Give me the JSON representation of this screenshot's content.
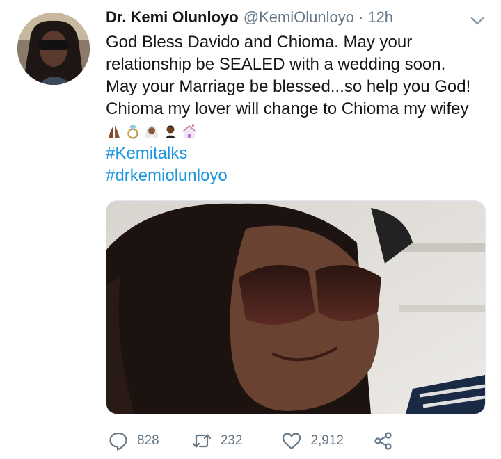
{
  "tweet": {
    "display_name": "Dr. Kemi Olunloyo",
    "handle": "@KemiOlunloyo",
    "separator": "·",
    "time": "12h",
    "lines": [
      "God Bless Davido and Chioma. May your",
      "relationship be SEALED with a wedding soon.",
      "May your Marriage be blessed...so help you God!",
      "Chioma my lover will change to Chioma my wifey"
    ],
    "emojis": [
      "praying-hands-icon",
      "ring-icon",
      "bride-icon",
      "groom-icon",
      "wedding-chapel-icon"
    ],
    "hashtags": [
      "#Kemitalks",
      "#drkemiolunloyo"
    ]
  },
  "actions": {
    "replies": "828",
    "retweets": "232",
    "likes": "2,912"
  },
  "colors": {
    "link": "#1b95e0",
    "secondary": "#657786",
    "text": "#14171a"
  }
}
